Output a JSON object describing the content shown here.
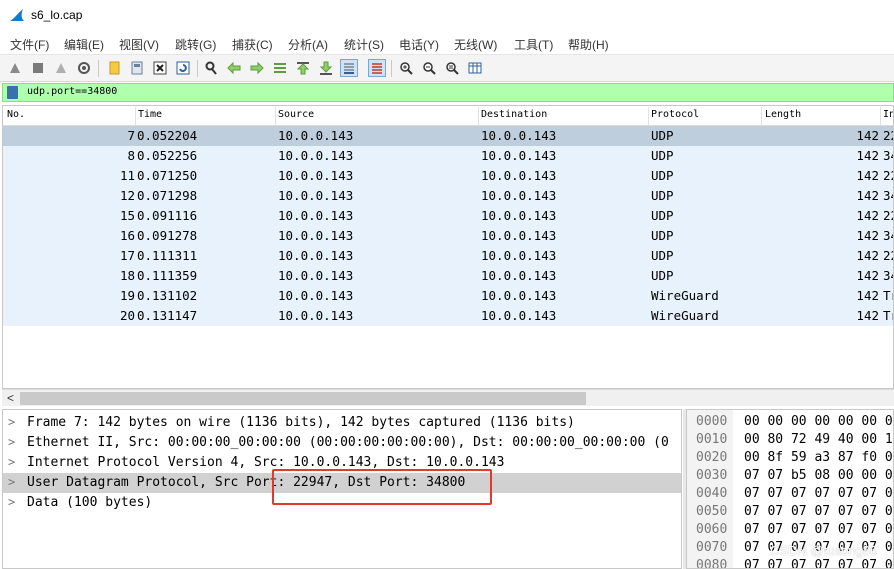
{
  "window": {
    "title": "s6_lo.cap",
    "icon": "wireshark-fin-icon"
  },
  "menu": [
    "文件(F)",
    "编辑(E)",
    "视图(V)",
    "跳转(G)",
    "捕获(C)",
    "分析(A)",
    "统计(S)",
    "电话(Y)",
    "无线(W)",
    "工具(T)",
    "帮助(H)"
  ],
  "toolbar": [
    "start-capture-icon",
    "stop-capture-icon",
    "restart-capture-icon",
    "capture-options-icon",
    "open-file-icon",
    "save-file-icon",
    "close-file-icon",
    "reload-file-icon",
    "find-packet-icon",
    "go-back-icon",
    "go-forward-icon",
    "go-to-packet-icon",
    "go-first-icon",
    "go-last-icon",
    "autoscroll-icon",
    "colorize-icon",
    "zoom-in-icon",
    "zoom-out-icon",
    "zoom-normal-icon",
    "resize-columns-icon"
  ],
  "filter": {
    "value": "udp.port==34800",
    "icon": "bookmark-icon"
  },
  "columns": [
    "No.",
    "Time",
    "Source",
    "Destination",
    "Protocol",
    "Length",
    "In"
  ],
  "packets": [
    {
      "no": "7",
      "time": "0.052204",
      "src": "10.0.0.143",
      "dst": "10.0.0.143",
      "proto": "UDP",
      "len": "142",
      "info": "22"
    },
    {
      "no": "8",
      "time": "0.052256",
      "src": "10.0.0.143",
      "dst": "10.0.0.143",
      "proto": "UDP",
      "len": "142",
      "info": "34"
    },
    {
      "no": "11",
      "time": "0.071250",
      "src": "10.0.0.143",
      "dst": "10.0.0.143",
      "proto": "UDP",
      "len": "142",
      "info": "22"
    },
    {
      "no": "12",
      "time": "0.071298",
      "src": "10.0.0.143",
      "dst": "10.0.0.143",
      "proto": "UDP",
      "len": "142",
      "info": "34"
    },
    {
      "no": "15",
      "time": "0.091116",
      "src": "10.0.0.143",
      "dst": "10.0.0.143",
      "proto": "UDP",
      "len": "142",
      "info": "22"
    },
    {
      "no": "16",
      "time": "0.091278",
      "src": "10.0.0.143",
      "dst": "10.0.0.143",
      "proto": "UDP",
      "len": "142",
      "info": "34"
    },
    {
      "no": "17",
      "time": "0.111311",
      "src": "10.0.0.143",
      "dst": "10.0.0.143",
      "proto": "UDP",
      "len": "142",
      "info": "22"
    },
    {
      "no": "18",
      "time": "0.111359",
      "src": "10.0.0.143",
      "dst": "10.0.0.143",
      "proto": "UDP",
      "len": "142",
      "info": "34"
    },
    {
      "no": "19",
      "time": "0.131102",
      "src": "10.0.0.143",
      "dst": "10.0.0.143",
      "proto": "WireGuard",
      "len": "142",
      "info": "Tr"
    },
    {
      "no": "20",
      "time": "0.131147",
      "src": "10.0.0.143",
      "dst": "10.0.0.143",
      "proto": "WireGuard",
      "len": "142",
      "info": "Tr"
    }
  ],
  "details": [
    "Frame 7: 142 bytes on wire (1136 bits), 142 bytes captured (1136 bits)",
    "Ethernet II, Src: 00:00:00_00:00:00 (00:00:00:00:00:00), Dst: 00:00:00_00:00:00 (0",
    "Internet Protocol Version 4, Src: 10.0.0.143, Dst: 10.0.0.143",
    "User Datagram Protocol, Src Port: 22947, Dst Port: 34800",
    "Data (100 bytes)"
  ],
  "bytes": [
    {
      "off": "0000",
      "hex": "00 00 00 00 00 00 0"
    },
    {
      "off": "0010",
      "hex": "00 80 72 49 40 00 1"
    },
    {
      "off": "0020",
      "hex": "00 8f 59 a3 87 f0 0"
    },
    {
      "off": "0030",
      "hex": "07 07 b5 08 00 00 0"
    },
    {
      "off": "0040",
      "hex": "07 07 07 07 07 07 0"
    },
    {
      "off": "0050",
      "hex": "07 07 07 07 07 07 0"
    },
    {
      "off": "0060",
      "hex": "07 07 07 07 07 07 0"
    },
    {
      "off": "0070",
      "hex": "07 07 07 07 07 07 0"
    },
    {
      "off": "0080",
      "hex": "07 07 07 07 07 07 0"
    }
  ],
  "watermark": "CSDN @tusong86",
  "colors": {
    "filter_bg": "#afffaf",
    "row_bg": "#e7f2fd",
    "row_selected": "#bfcedc",
    "highlight_box": "#e03a2f"
  }
}
